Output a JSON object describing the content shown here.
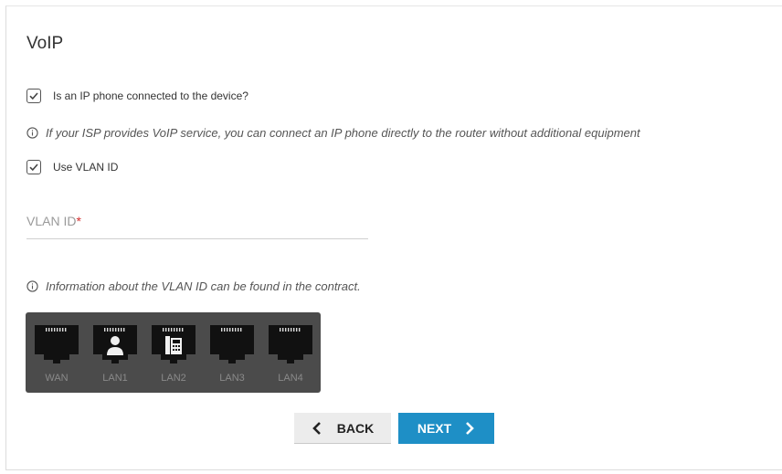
{
  "page": {
    "title": "VoIP"
  },
  "options": {
    "ip_phone": {
      "label": "Is an IP phone connected to the device?",
      "checked": true
    },
    "ip_phone_info": "If your ISP provides VoIP service, you can connect an IP phone directly to the router without additional equipment",
    "use_vlan": {
      "label": "Use VLAN ID",
      "checked": true
    }
  },
  "vlan_field": {
    "label": "VLAN ID",
    "required_mark": "*",
    "value": ""
  },
  "vlan_info": "Information about the VLAN ID can be found in the contract.",
  "ports": [
    {
      "label": "WAN",
      "icon": "none"
    },
    {
      "label": "LAN1",
      "icon": "user-icon"
    },
    {
      "label": "LAN2",
      "icon": "phone-icon"
    },
    {
      "label": "LAN3",
      "icon": "none"
    },
    {
      "label": "LAN4",
      "icon": "none"
    }
  ],
  "buttons": {
    "back": "BACK",
    "next": "NEXT"
  },
  "colors": {
    "accent": "#1e8fc6",
    "port_panel": "#4b4b4b",
    "required": "#d32f2f"
  }
}
